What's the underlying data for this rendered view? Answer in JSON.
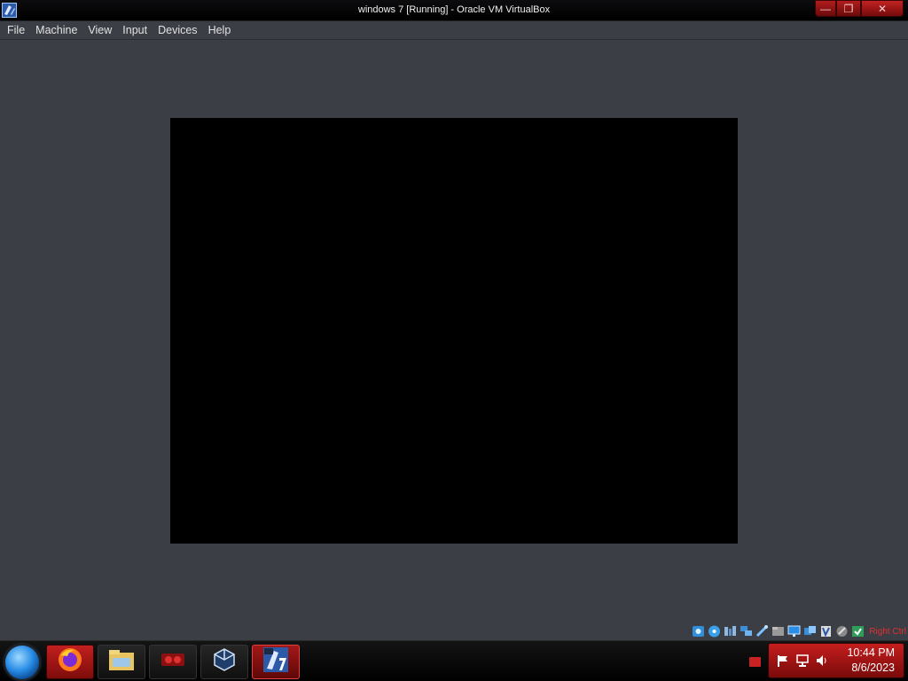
{
  "window": {
    "title": "windows 7 [Running] - Oracle VM VirtualBox"
  },
  "menu": {
    "items": [
      "File",
      "Machine",
      "View",
      "Input",
      "Devices",
      "Help"
    ]
  },
  "statusbar": {
    "icons": [
      "hard-disk-icon",
      "optical-drive-icon",
      "audio-icon",
      "network-icon",
      "usb-icon",
      "shared-folders-icon",
      "display-icon",
      "video-capture-icon",
      "cpu-icon",
      "mouse-integration-icon",
      "keyboard-icon"
    ],
    "host_key": "Right Ctrl"
  },
  "taskbar": {
    "buttons": [
      "firefox-icon",
      "file-explorer-icon",
      "media-app-icon",
      "virtualbox-icon",
      "windows7-vm-icon"
    ],
    "clock": {
      "time": "10:44 PM",
      "date": "8/6/2023"
    }
  },
  "colors": {
    "window_bg": "#3b3e44",
    "vm_screen": "#000000",
    "accent_red": "#c21f1f"
  }
}
